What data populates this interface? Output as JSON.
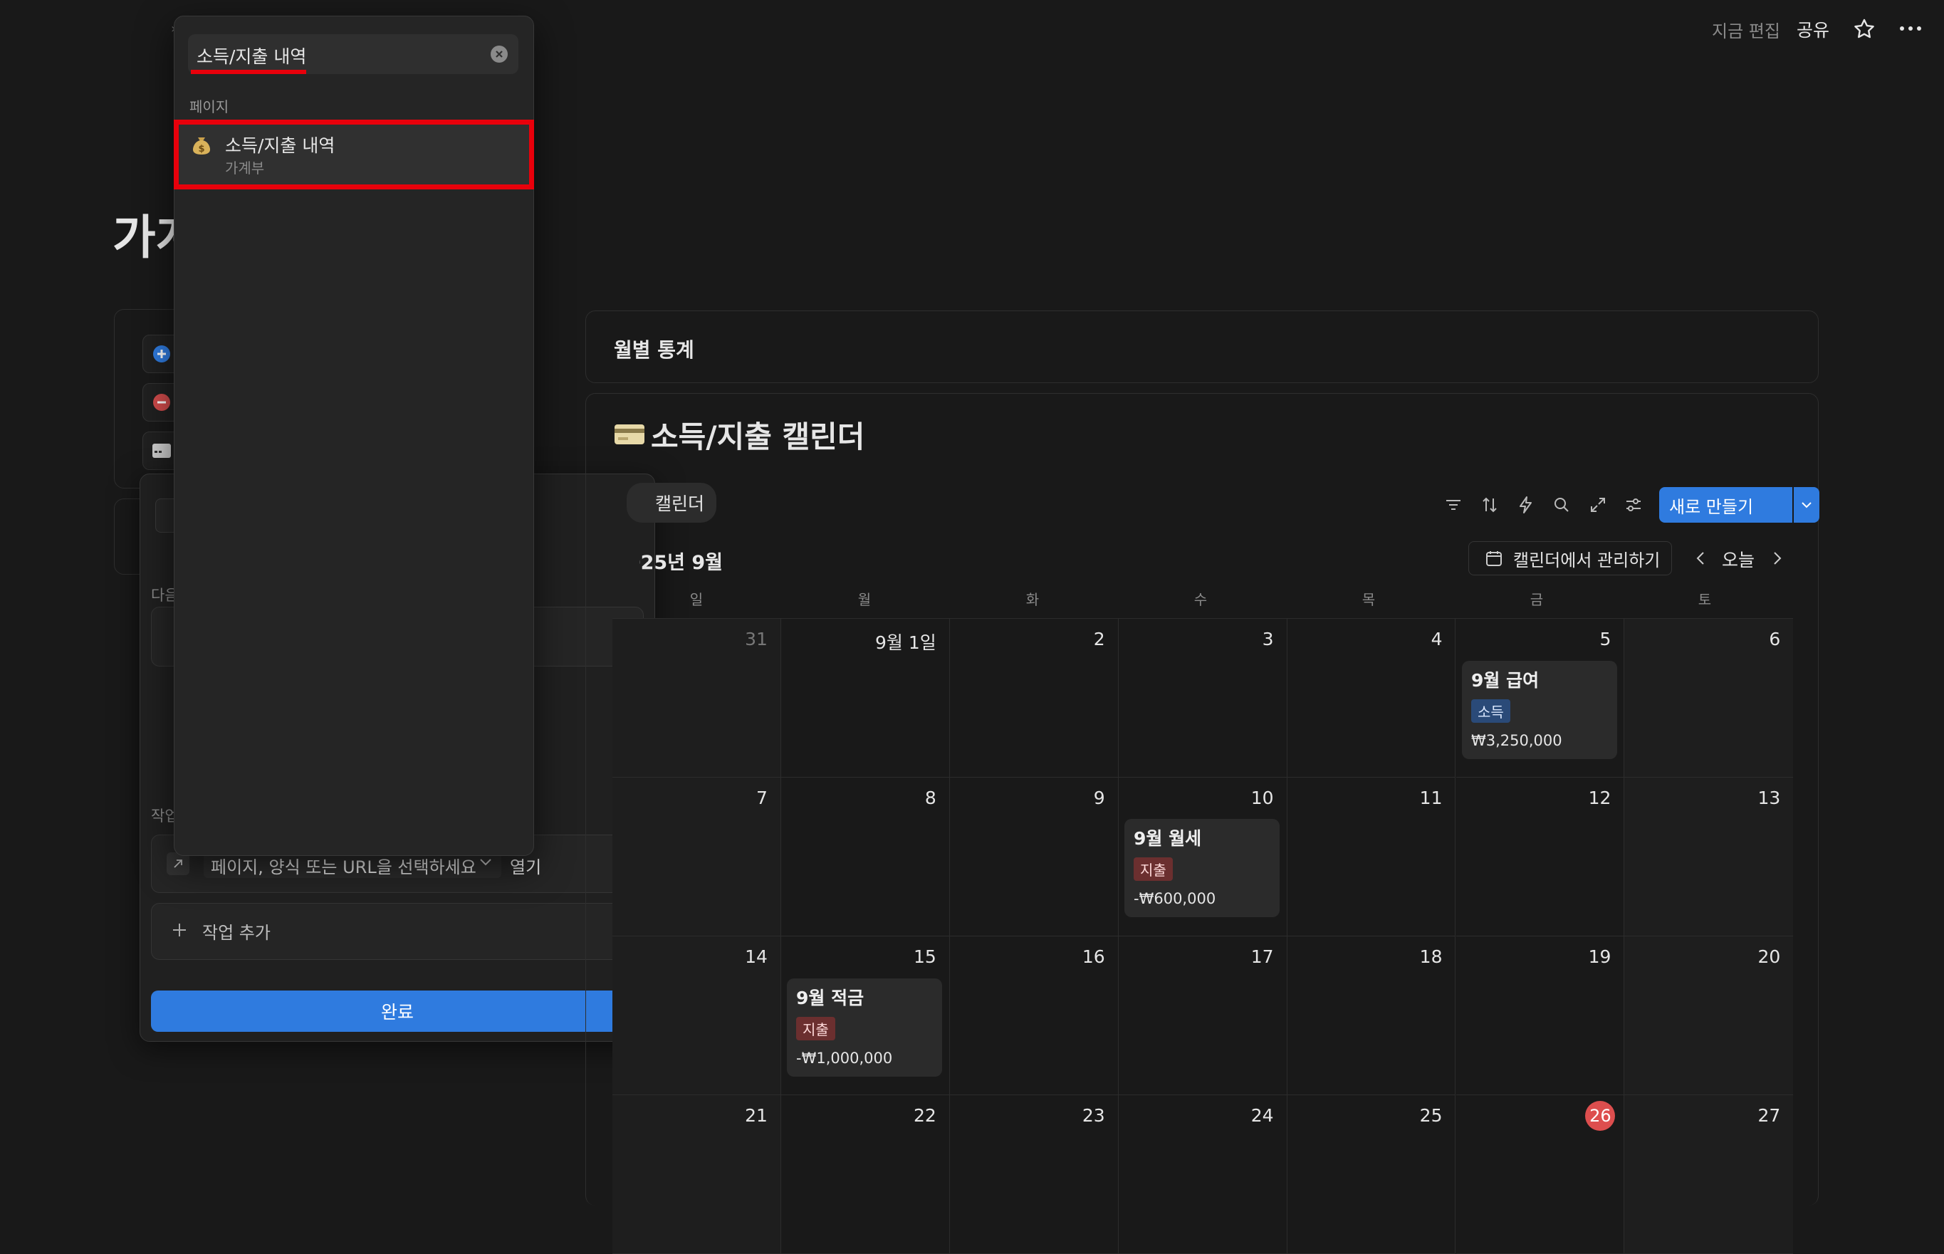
{
  "topbar": {
    "edited": "지금 편집",
    "share": "공유"
  },
  "page": {
    "title_partial": "가계"
  },
  "modal": {
    "label_next": "다음",
    "label_action": "작업",
    "open_page_placeholder": "페이지, 양식 또는 URL을 선택하세요",
    "open_suffix": "열기",
    "add_action": "작업 추가",
    "done": "완료"
  },
  "search_dropdown": {
    "query": "소득/지출 내역",
    "section": "페이지",
    "results": [
      {
        "icon": "money-bag-icon",
        "title": "소득/지출 내역",
        "subtitle": "가계부"
      }
    ]
  },
  "monthly_stats": {
    "title": "월별 통계"
  },
  "calendar": {
    "title": "소득/지출 캘린더",
    "view_tab": "캘린더",
    "new_button": "새로 만들기",
    "manage_button": "캘린더에서 관리하기",
    "month": "2025년 9월",
    "today": "오늘",
    "weekdays": [
      "일",
      "월",
      "화",
      "수",
      "목",
      "금",
      "토"
    ],
    "weeks": [
      [
        "31",
        "9월 1일",
        "2",
        "3",
        "4",
        "5",
        "6"
      ],
      [
        "7",
        "8",
        "9",
        "10",
        "11",
        "12",
        "13"
      ],
      [
        "14",
        "15",
        "16",
        "17",
        "18",
        "19",
        "20"
      ],
      [
        "21",
        "22",
        "23",
        "24",
        "25",
        "26",
        "27"
      ]
    ],
    "events": {
      "salary": {
        "title": "9월 급여",
        "tag": "소득",
        "amount": "₩3,250,000"
      },
      "rent": {
        "title": "9월 월세",
        "tag": "지출",
        "amount": "-₩600,000"
      },
      "saving": {
        "title": "9월 적금",
        "tag": "지출",
        "amount": "-₩1,000,000"
      }
    },
    "today_date": "26"
  },
  "colors": {
    "background": "#191919",
    "accent": "#2f7bdf",
    "highlight": "#e8000b",
    "income_tag": "#2a4a78",
    "expense_tag": "#6b2f2f",
    "today": "#dd4e4e"
  }
}
